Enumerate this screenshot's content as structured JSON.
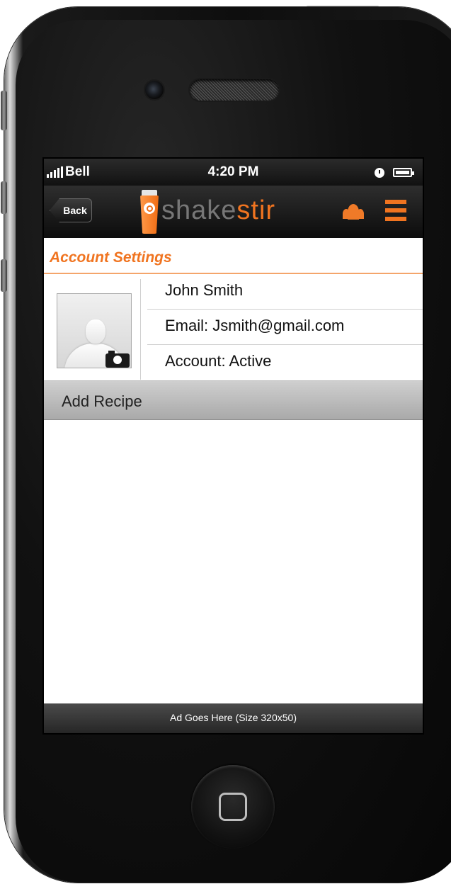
{
  "status_bar": {
    "carrier": "Bell",
    "time": "4:20 PM",
    "icons": [
      "signal-icon",
      "alarm-icon",
      "battery-icon"
    ]
  },
  "nav": {
    "back_label": "Back",
    "logo_part1": "shake",
    "logo_part2": "stir",
    "icons": [
      "people-icon",
      "menu-icon"
    ]
  },
  "page": {
    "title": "Account Settings"
  },
  "profile": {
    "name": "John Smith",
    "email": "Email: Jsmith@gmail.com",
    "account": "Account: Active",
    "avatar_icon": "camera-icon"
  },
  "actions": {
    "add_recipe": "Add Recipe"
  },
  "ad": {
    "text": "Ad Goes Here (Size 320x50)"
  },
  "colors": {
    "accent": "#f07420",
    "nav_bg": "#141414",
    "button_gray": "#bdbdbd"
  }
}
